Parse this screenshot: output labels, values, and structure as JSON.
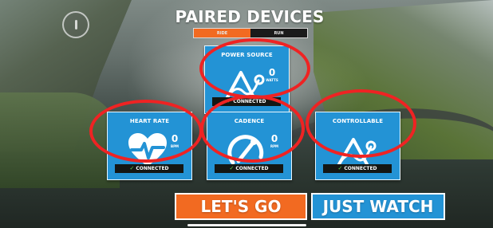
{
  "header": {
    "title": "PAIRED DEVICES",
    "tabs": [
      {
        "label": "RIDE"
      },
      {
        "label": "RUN"
      }
    ]
  },
  "devices": [
    {
      "label": "POWER SOURCE",
      "value": "0",
      "unit": "WATTS",
      "status": "CONNECTED"
    },
    {
      "label": "HEART RATE",
      "value": "0",
      "unit": "BPM",
      "status": "CONNECTED"
    },
    {
      "label": "CADENCE",
      "value": "0",
      "unit": "RPM",
      "status": "CONNECTED"
    },
    {
      "label": "CONTROLLABLE",
      "value": "",
      "unit": "",
      "status": "CONNECTED"
    }
  ],
  "actions": {
    "lets_go": "LET'S GO",
    "just_watch": "JUST WATCH"
  },
  "colors": {
    "orange": "#f26a21",
    "blue": "#2393d5",
    "highlight": "#ef2323",
    "connected": "#5fd14d"
  },
  "icons": {
    "info": "info-icon",
    "power": "power-source-icon",
    "heart": "heart-rate-icon",
    "cadence": "cadence-icon",
    "controllable": "controllable-icon",
    "connected": "check-icon"
  }
}
